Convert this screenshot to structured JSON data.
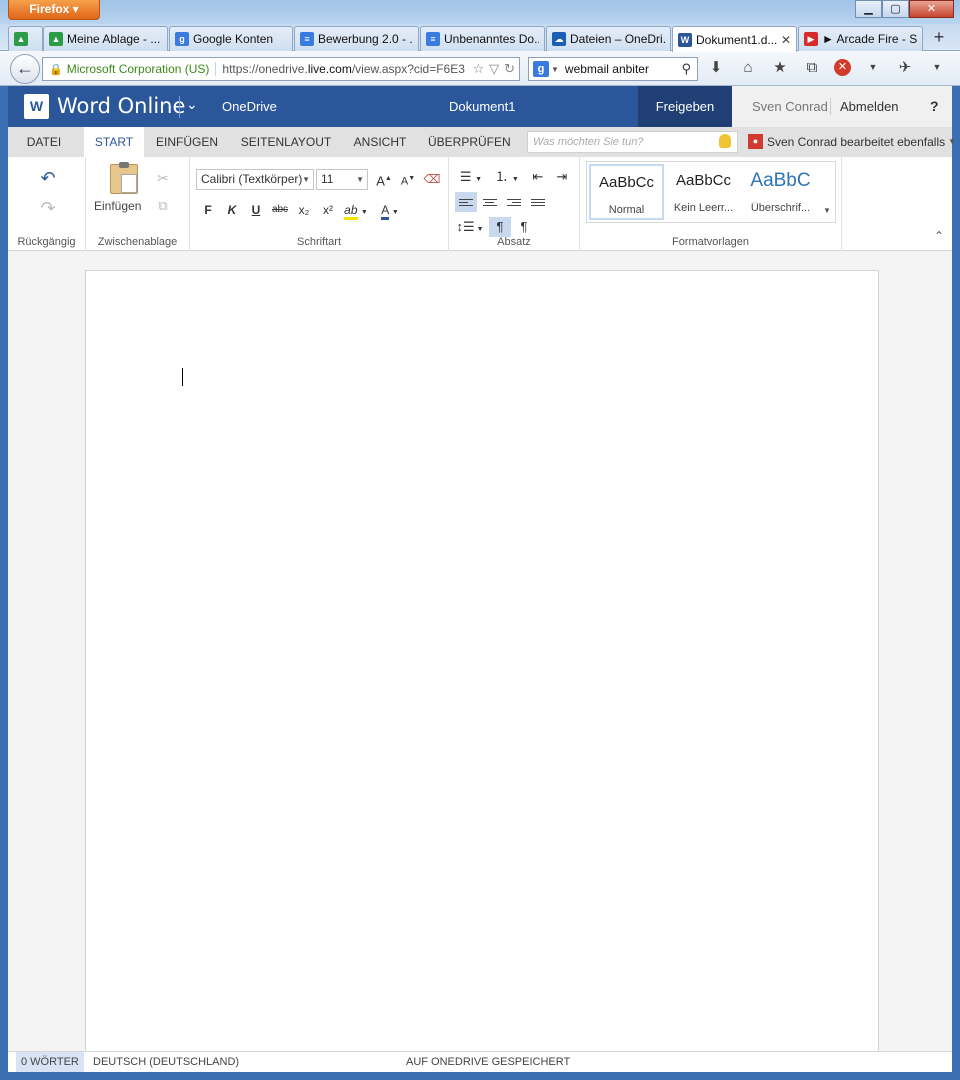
{
  "browser": {
    "menu_button": "Firefox",
    "window_buttons": {
      "minimize": "▁",
      "maximize": "▢",
      "close": "✕"
    },
    "tabs": [
      {
        "label": "",
        "icon": "google-drive-icon",
        "color": "#2d9b48"
      },
      {
        "label": "Meine Ablage - ...",
        "icon": "google-drive-icon",
        "color": "#2d9b48"
      },
      {
        "label": "Google Konten",
        "icon": "google-icon",
        "color": "#3a7be0"
      },
      {
        "label": "Bewerbung 2.0 - ...",
        "icon": "google-docs-icon",
        "color": "#3a7be0"
      },
      {
        "label": "Unbenanntes Do...",
        "icon": "google-docs-icon",
        "color": "#3a7be0"
      },
      {
        "label": "Dateien – OneDri...",
        "icon": "onedrive-icon",
        "color": "#1a5fb4"
      },
      {
        "label": "Dokument1.d...",
        "icon": "word-icon",
        "color": "#2b579a"
      },
      {
        "label": "► Arcade Fire - S...",
        "icon": "youtube-icon",
        "color": "#d62b2b"
      }
    ],
    "new_tab": "+",
    "identity": "Microsoft Corporation (US)",
    "url_prefix": "https://onedrive.",
    "url_domain": "live.com",
    "url_suffix": "/view.aspx?cid=F6E3",
    "search_value": "webmail anbiter"
  },
  "app": {
    "name": "Word Online",
    "location": "OneDrive",
    "document_title": "Dokument1",
    "share_label": "Freigeben",
    "user_name": "Sven Conrad",
    "logout_label": "Abmelden",
    "help_label": "?",
    "brand_color": "#2b579a"
  },
  "ribbon_tabs": [
    {
      "label": "DATEI"
    },
    {
      "label": "START",
      "active": true
    },
    {
      "label": "EINFÜGEN"
    },
    {
      "label": "SEITENLAYOUT"
    },
    {
      "label": "ANSICHT"
    },
    {
      "label": "ÜBERPRÜFEN"
    }
  ],
  "tellme_placeholder": "Was möchten Sie tun?",
  "coauthor_text": "Sven Conrad bearbeitet ebenfalls",
  "groups": {
    "undo": "Rückgängig",
    "clipboard": "Zwischenablage",
    "font": "Schriftart",
    "paragraph": "Absatz",
    "styles": "Formatvorlagen"
  },
  "clipboard": {
    "paste_label": "Einfügen"
  },
  "font": {
    "name": "Calibri (Textkörper)",
    "size": "11",
    "grow": "A",
    "shrink": "A",
    "bold": "F",
    "italic": "K",
    "underline": "U",
    "strike": "abc",
    "subscript": "x₂",
    "superscript": "x²",
    "highlight": "ab",
    "font_color": "A"
  },
  "paragraph": {
    "ltr": "¶",
    "rtl": "¶"
  },
  "styles": [
    {
      "sample": "AaBbCc",
      "name": "Normal",
      "selected": true
    },
    {
      "sample": "AaBbCc",
      "name": "Kein Leerr..."
    },
    {
      "sample": "AaBbC",
      "name": "Überschrif...",
      "heading": true
    }
  ],
  "status": {
    "word_count": "0 WÖRTER",
    "language": "DEUTSCH (DEUTSCHLAND)",
    "save_state": "AUF ONEDRIVE GESPEICHERT"
  }
}
